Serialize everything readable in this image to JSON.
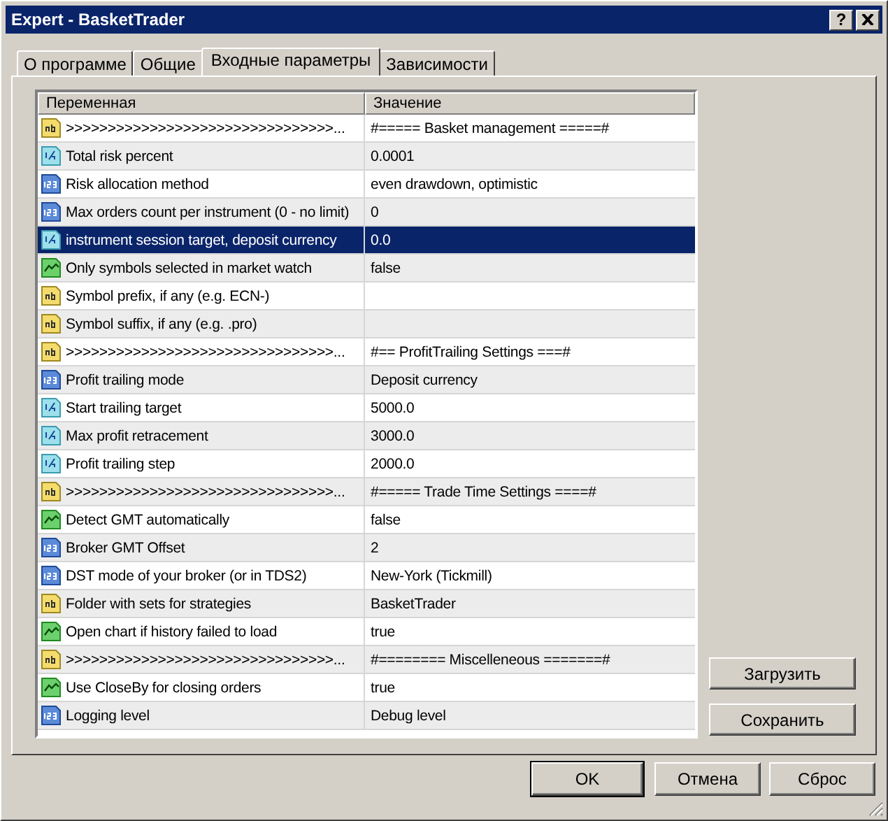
{
  "window": {
    "title": "Expert - BasketTrader",
    "title_buttons": [
      {
        "kind": "help",
        "label": "?"
      },
      {
        "kind": "close"
      }
    ]
  },
  "tabs": [
    {
      "label": "О программе",
      "selected": false
    },
    {
      "label": "Общие",
      "selected": false
    },
    {
      "label": "Входные параметры",
      "selected": true
    },
    {
      "label": "Зависимости",
      "selected": false
    }
  ],
  "table": {
    "columns": [
      "Переменная",
      "Значение"
    ],
    "rows": [
      {
        "kind": "string",
        "name": ">>>>>>>>>>>>>>>>>>>>>>>>>>>>>>>>...",
        "value": "#===== Basket management =====#",
        "selected": false
      },
      {
        "kind": "double",
        "name": "Total risk percent",
        "value": "0.0001",
        "selected": false
      },
      {
        "kind": "enum",
        "name": "Risk allocation method",
        "value": "even drawdown, optimistic",
        "selected": false
      },
      {
        "kind": "enum",
        "name": "Max orders count per instrument (0 - no limit)",
        "value": "0",
        "selected": false
      },
      {
        "kind": "double",
        "name": "instrument session target, deposit currency",
        "value": "0.0",
        "selected": true
      },
      {
        "kind": "bool",
        "name": "Only symbols selected in market watch",
        "value": "false",
        "selected": false
      },
      {
        "kind": "string",
        "name": "Symbol prefix, if any (e.g. ECN-)",
        "selected": false
      },
      {
        "kind": "string",
        "name": "Symbol suffix, if any (e.g. .pro)",
        "selected": false
      },
      {
        "kind": "string",
        "name": ">>>>>>>>>>>>>>>>>>>>>>>>>>>>>>>>...",
        "value": "#== ProfitTrailing Settings ===#",
        "selected": false
      },
      {
        "kind": "enum",
        "name": "Profit trailing mode",
        "value": "Deposit currency",
        "selected": false
      },
      {
        "kind": "double",
        "name": "Start trailing target",
        "value": "5000.0",
        "selected": false
      },
      {
        "kind": "double",
        "name": "Max profit retracement",
        "value": "3000.0",
        "selected": false
      },
      {
        "kind": "double",
        "name": "Profit trailing step",
        "value": "2000.0",
        "selected": false
      },
      {
        "kind": "string",
        "name": ">>>>>>>>>>>>>>>>>>>>>>>>>>>>>>>>...",
        "value": "#===== Trade Time Settings ====#",
        "selected": false
      },
      {
        "kind": "bool",
        "name": "Detect GMT automatically",
        "value": "false",
        "selected": false
      },
      {
        "kind": "enum",
        "name": "Broker GMT Offset",
        "value": "2",
        "selected": false
      },
      {
        "kind": "enum",
        "name": "DST mode of your broker (or in TDS2)",
        "value": "New-York (Tickmill)",
        "selected": false
      },
      {
        "kind": "string",
        "name": "Folder with sets for strategies",
        "value": "BasketTrader",
        "selected": false
      },
      {
        "kind": "bool",
        "name": "Open chart if history failed to load",
        "value": "true",
        "selected": false
      },
      {
        "kind": "string",
        "name": ">>>>>>>>>>>>>>>>>>>>>>>>>>>>>>>>...",
        "value": "#======== Miscelleneous =======#",
        "selected": false
      },
      {
        "kind": "bool",
        "name": "Use CloseBy for closing orders",
        "value": "true",
        "selected": false
      },
      {
        "kind": "enum",
        "name": "Logging  level",
        "value": "Debug level",
        "selected": false
      }
    ]
  },
  "side_buttons": [
    "Загрузить",
    "Сохранить"
  ],
  "footer_buttons": [
    {
      "label": "OK",
      "default": true
    },
    {
      "label": "Отмена",
      "default": false
    },
    {
      "label": "Сброс",
      "default": false
    }
  ]
}
